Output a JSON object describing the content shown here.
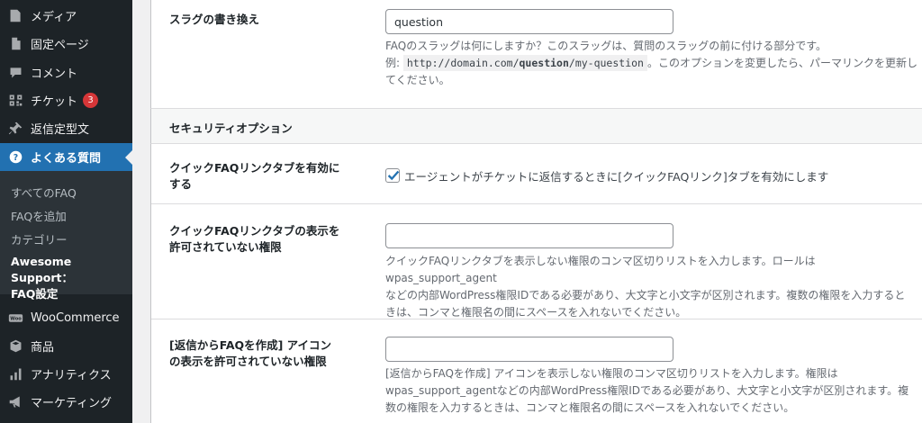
{
  "sidebar": {
    "items": [
      {
        "label": "メディア",
        "icon": "media-icon"
      },
      {
        "label": "固定ページ",
        "icon": "page-icon"
      },
      {
        "label": "コメント",
        "icon": "comment-icon"
      },
      {
        "label": "チケット",
        "icon": "ticket-icon",
        "badge": "3"
      },
      {
        "label": "返信定型文",
        "icon": "pin-icon"
      },
      {
        "label": "よくある質問",
        "icon": "question-icon"
      },
      {
        "label": "WooCommerce",
        "icon": "woocommerce-icon"
      },
      {
        "label": "商品",
        "icon": "box-icon"
      },
      {
        "label": "アナリティクス",
        "icon": "analytics-icon"
      },
      {
        "label": "マーケティング",
        "icon": "megaphone-icon"
      }
    ],
    "submenu": [
      {
        "label": "すべてのFAQ"
      },
      {
        "label": "FAQを追加"
      },
      {
        "label": "カテゴリー"
      },
      {
        "label_line1": "Awesome Support：",
        "label_line2": "FAQ設定"
      }
    ]
  },
  "settings": {
    "slug": {
      "label": "スラグの書き換え",
      "value": "question",
      "desc_line1": "FAQのスラッグは何にしますか？このスラッグは、質問のスラッグの前に付ける部分です。",
      "desc_example_prefix": "例:",
      "desc_code_pre": "http://domain.com/",
      "desc_code_bold": "question",
      "desc_code_post": "/my-question",
      "desc_after_code": "。このオプションを変更したら、パーマリンクを更新し",
      "desc_line3": "てください。"
    },
    "security_heading": "セキュリティオプション",
    "quick_faq_enable": {
      "label_line1": "クイックFAQリンクタブを有効に",
      "label_line2": "する",
      "checked": true,
      "check_label": "エージェントがチケットに返信するときに[クイックFAQリンク]タブを有効にします"
    },
    "quick_faq_permission": {
      "label_line1": "クイックFAQリンクタブの表示を",
      "label_line2": "許可されていない権限",
      "value": "",
      "desc_line1": "クイックFAQリンクタブを表示しない権限のコンマ区切りリストを入力します。ロールはwpas_support_agent",
      "desc_line2": "などの内部WordPress権限IDである必要があり、大文字と小文字が区別されます。複数の権限を入力すると",
      "desc_line3": "きは、コンマと権限名の間にスペースを入れないでください。"
    },
    "reply_faq_permission": {
      "label_line1": "[返信からFAQを作成] アイコン",
      "label_line2": "の表示を許可されていない権限",
      "value": "",
      "desc_line1": "[返信からFAQを作成] アイコンを表示しない権限のコンマ区切りリストを入力します。権限は",
      "desc_line2": "wpas_support_agentなどの内部WordPress権限IDである必要があり、大文字と小文字が区別されます。複",
      "desc_line3": "数の権限を入力するときは、コンマと権限名の間にスペースを入れないでください。"
    }
  }
}
